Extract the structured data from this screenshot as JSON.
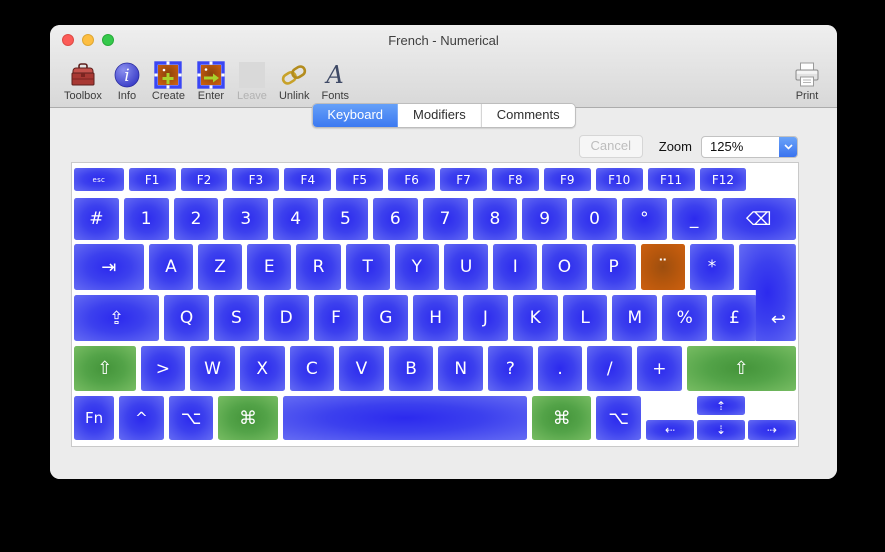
{
  "window": {
    "title": "French - Numerical"
  },
  "toolbar": {
    "items": [
      {
        "name": "toolbox",
        "icon": "toolbox-icon",
        "label": "Toolbox"
      },
      {
        "name": "info",
        "icon": "info-icon",
        "label": "Info"
      },
      {
        "name": "create",
        "icon": "create-icon",
        "label": "Create"
      },
      {
        "name": "enter",
        "icon": "enter-icon",
        "label": "Enter"
      },
      {
        "name": "leave",
        "icon": "leave-icon",
        "label": "Leave",
        "disabled": true
      },
      {
        "name": "unlink",
        "icon": "unlink-icon",
        "label": "Unlink"
      },
      {
        "name": "fonts",
        "icon": "fonts-icon",
        "label": "Fonts"
      }
    ],
    "print_label": "Print"
  },
  "tabs": {
    "items": [
      {
        "label": "Keyboard",
        "selected": true
      },
      {
        "label": "Modifiers",
        "selected": false
      },
      {
        "label": "Comments",
        "selected": false
      }
    ]
  },
  "controls": {
    "cancel_label": "Cancel",
    "zoom_label": "Zoom",
    "zoom_value": "125%"
  },
  "colors": {
    "key_blue": "#3c40ee",
    "key_green": "#53a348",
    "key_orange": "#b4560d",
    "tab_selected_blue": "#3c79f1"
  },
  "keyboard": {
    "rows": [
      {
        "name": "function-row",
        "keys": [
          {
            "n": "esc",
            "l": "esc",
            "w": 1.06,
            "fs": "xs"
          },
          {
            "n": "f1",
            "l": "F1",
            "fs": "sm"
          },
          {
            "n": "f2",
            "l": "F2",
            "fs": "sm"
          },
          {
            "n": "f3",
            "l": "F3",
            "fs": "sm"
          },
          {
            "n": "f4",
            "l": "F4",
            "fs": "sm"
          },
          {
            "n": "f5",
            "l": "F5",
            "fs": "sm"
          },
          {
            "n": "f6",
            "l": "F6",
            "fs": "sm"
          },
          {
            "n": "f7",
            "l": "F7",
            "fs": "sm"
          },
          {
            "n": "f8",
            "l": "F8",
            "fs": "sm"
          },
          {
            "n": "f9",
            "l": "F9",
            "fs": "sm"
          },
          {
            "n": "f10",
            "l": "F10",
            "fs": "sm"
          },
          {
            "n": "f11",
            "l": "F11",
            "fs": "sm"
          },
          {
            "n": "f12",
            "l": "F12",
            "fs": "sm"
          },
          {
            "type": "spacer",
            "w": 0.95
          }
        ]
      },
      {
        "name": "number-row",
        "keys": [
          {
            "n": "hash",
            "l": "#"
          },
          {
            "n": "1",
            "l": "1"
          },
          {
            "n": "2",
            "l": "2"
          },
          {
            "n": "3",
            "l": "3"
          },
          {
            "n": "4",
            "l": "4"
          },
          {
            "n": "5",
            "l": "5"
          },
          {
            "n": "6",
            "l": "6"
          },
          {
            "n": "7",
            "l": "7"
          },
          {
            "n": "8",
            "l": "8"
          },
          {
            "n": "9",
            "l": "9"
          },
          {
            "n": "0",
            "l": "0"
          },
          {
            "n": "degree",
            "l": "°"
          },
          {
            "n": "underscore",
            "l": "_"
          },
          {
            "n": "backspace",
            "l": "⌫",
            "w": 1.66,
            "fs": "glyph"
          }
        ]
      },
      {
        "name": "top-letter-row",
        "keys": [
          {
            "n": "tab",
            "l": "⇥",
            "w": 1.58,
            "fs": "glyph"
          },
          {
            "n": "a",
            "l": "A"
          },
          {
            "n": "z",
            "l": "Z"
          },
          {
            "n": "e",
            "l": "E"
          },
          {
            "n": "r",
            "l": "R"
          },
          {
            "n": "t",
            "l": "T"
          },
          {
            "n": "y",
            "l": "Y"
          },
          {
            "n": "u",
            "l": "U"
          },
          {
            "n": "i",
            "l": "I"
          },
          {
            "n": "o",
            "l": "O"
          },
          {
            "n": "p",
            "l": "P"
          },
          {
            "n": "dead-diaeresis",
            "l": "¨",
            "color": "orange",
            "fs": "lg"
          },
          {
            "n": "asterisk",
            "l": "*"
          },
          {
            "n": "return",
            "l": "↩",
            "w": 1.06,
            "type": "enter",
            "fs": "glyph"
          }
        ]
      },
      {
        "name": "home-letter-row",
        "keys": [
          {
            "n": "capslock",
            "l": "⇪",
            "w": 1.9,
            "fs": "glyph"
          },
          {
            "n": "q",
            "l": "Q"
          },
          {
            "n": "s",
            "l": "S"
          },
          {
            "n": "d",
            "l": "D"
          },
          {
            "n": "f",
            "l": "F"
          },
          {
            "n": "g",
            "l": "G"
          },
          {
            "n": "h",
            "l": "H"
          },
          {
            "n": "j",
            "l": "J"
          },
          {
            "n": "k",
            "l": "K"
          },
          {
            "n": "l",
            "l": "L"
          },
          {
            "n": "m",
            "l": "M"
          },
          {
            "n": "percent",
            "l": "%"
          },
          {
            "n": "pound",
            "l": "£"
          },
          {
            "type": "spacer",
            "w": 0.76
          }
        ]
      },
      {
        "name": "bottom-letter-row",
        "keys": [
          {
            "n": "shift-left",
            "l": "⇧",
            "w": 1.38,
            "color": "green",
            "fs": "glyph"
          },
          {
            "n": "greater-than",
            "l": ">"
          },
          {
            "n": "w",
            "l": "W"
          },
          {
            "n": "x",
            "l": "X"
          },
          {
            "n": "c",
            "l": "C"
          },
          {
            "n": "v",
            "l": "V"
          },
          {
            "n": "b",
            "l": "B"
          },
          {
            "n": "n",
            "l": "N"
          },
          {
            "n": "question",
            "l": "?"
          },
          {
            "n": "period",
            "l": "."
          },
          {
            "n": "slash",
            "l": "/"
          },
          {
            "n": "plus",
            "l": "+"
          },
          {
            "n": "shift-right",
            "l": "⇧",
            "w": 2.45,
            "color": "green",
            "fs": "glyph"
          }
        ]
      },
      {
        "name": "modifier-row",
        "keys": [
          {
            "n": "fn",
            "l": "Fn",
            "w": 0.9,
            "fs": "md2"
          },
          {
            "n": "control",
            "l": "^",
            "fs": "md2"
          },
          {
            "n": "option-left",
            "l": "⌥",
            "fs": "glyph"
          },
          {
            "n": "command-left",
            "l": "⌘",
            "w": 1.33,
            "color": "green",
            "fs": "glyph"
          },
          {
            "n": "space",
            "l": "",
            "w": 5.48
          },
          {
            "n": "command-right",
            "l": "⌘",
            "w": 1.33,
            "color": "green",
            "fs": "glyph"
          },
          {
            "n": "option-right",
            "l": "⌥",
            "fs": "glyph"
          },
          {
            "type": "arrows",
            "keys": [
              {
                "n": "arrow-up",
                "l": "⇡"
              },
              {
                "n": "arrow-left",
                "l": "⇠"
              },
              {
                "n": "arrow-down",
                "l": "⇣"
              },
              {
                "n": "arrow-right",
                "l": "⇢"
              }
            ]
          }
        ]
      }
    ]
  }
}
